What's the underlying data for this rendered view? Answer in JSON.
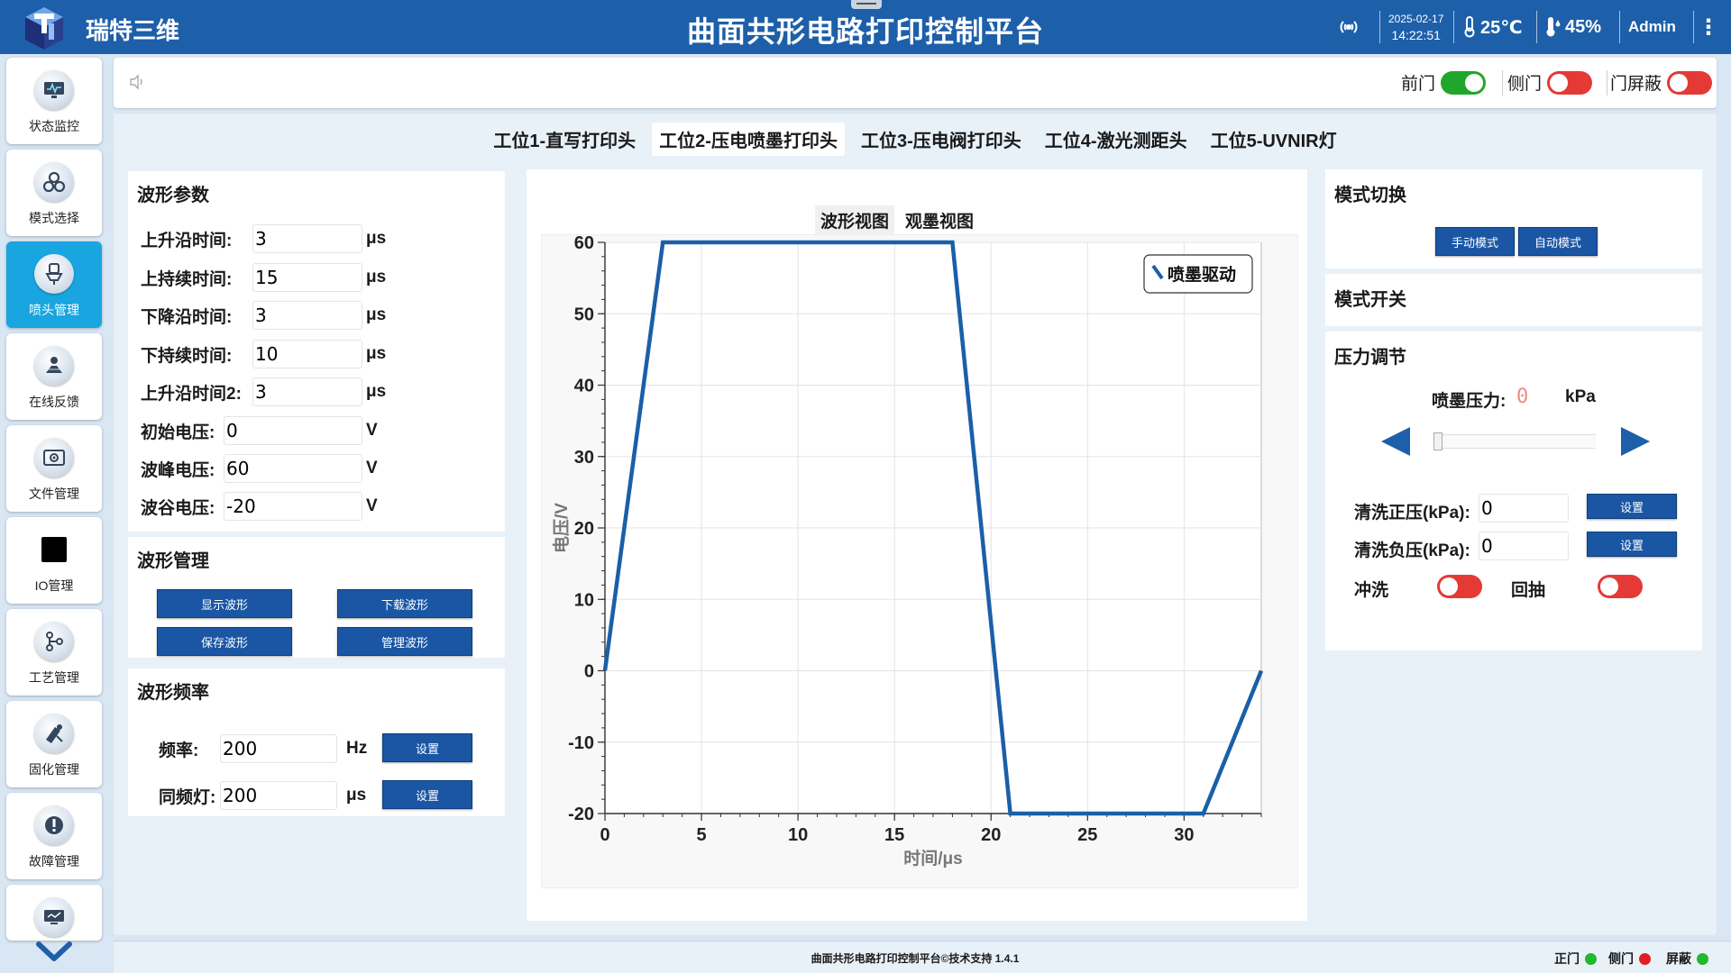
{
  "header": {
    "brand": "瑞特三维",
    "title": "曲面共形电路打印控制平台",
    "date": "2025-02-17",
    "time": "14:22:51",
    "temperature": "25℃",
    "humidity": "45%",
    "user": "Admin",
    "menu_glyph": "⋮"
  },
  "sidebar": {
    "items": [
      {
        "label": "状态监控",
        "icon": "monitor-icon"
      },
      {
        "label": "模式选择",
        "icon": "cubes-icon"
      },
      {
        "label": "喷头管理",
        "icon": "nozzle-icon",
        "active": true
      },
      {
        "label": "在线反馈",
        "icon": "feedback-icon"
      },
      {
        "label": "文件管理",
        "icon": "folder-icon"
      },
      {
        "label": "IO管理",
        "icon": "io-icon"
      },
      {
        "label": "工艺管理",
        "icon": "process-icon"
      },
      {
        "label": "固化管理",
        "icon": "curing-icon"
      },
      {
        "label": "故障管理",
        "icon": "alert-icon"
      },
      {
        "label": "",
        "icon": "screen-icon"
      }
    ]
  },
  "toolbar": {
    "doors": [
      {
        "label": "前门",
        "state": "on"
      },
      {
        "label": "侧门",
        "state": "off"
      },
      {
        "label": "门屏蔽",
        "state": "off"
      }
    ]
  },
  "tabs": [
    "工位1-直写打印头",
    "工位2-压电喷墨打印头",
    "工位3-压电阀打印头",
    "工位4-激光测距头",
    "工位5-UVNIR灯"
  ],
  "active_tab": 1,
  "waveform_params": {
    "title": "波形参数",
    "rows": [
      {
        "label": "上升沿时间:",
        "value": "3",
        "unit": "μs"
      },
      {
        "label": "上持续时间:",
        "value": "15",
        "unit": "μs"
      },
      {
        "label": "下降沿时间:",
        "value": "3",
        "unit": "μs"
      },
      {
        "label": "下持续时间:",
        "value": "10",
        "unit": "μs"
      },
      {
        "label": "上升沿时间2:",
        "value": "3",
        "unit": "μs"
      },
      {
        "label": "初始电压:",
        "value": "0",
        "unit": "V"
      },
      {
        "label": "波峰电压:",
        "value": "60",
        "unit": "V"
      },
      {
        "label": "波谷电压:",
        "value": "-20",
        "unit": "V"
      }
    ]
  },
  "waveform_manage": {
    "title": "波形管理",
    "buttons": [
      "显示波形",
      "下载波形",
      "保存波形",
      "管理波形"
    ]
  },
  "waveform_freq": {
    "title": "波形频率",
    "freq_label": "频率:",
    "freq_value": "200",
    "freq_unit": "Hz",
    "sync_label": "同频灯:",
    "sync_value": "200",
    "sync_unit": "μs",
    "set_label": "设置"
  },
  "chart_view": {
    "tabs": [
      "波形视图",
      "观墨视图"
    ],
    "active": 0
  },
  "chart_data": {
    "type": "line",
    "xlabel": "时间/μs",
    "ylabel": "电压/V",
    "xlim": [
      0,
      34
    ],
    "ylim": [
      -20,
      60
    ],
    "xticks": [
      0,
      5,
      10,
      15,
      20,
      25,
      30
    ],
    "yticks": [
      -20,
      -10,
      0,
      10,
      20,
      30,
      40,
      50,
      60
    ],
    "legend": "top-right",
    "grid": true,
    "series": [
      {
        "name": "喷墨驱动",
        "color": "#1a5fa8",
        "x": [
          0,
          3,
          18,
          21,
          31,
          34
        ],
        "y": [
          0,
          60,
          60,
          -20,
          -20,
          0
        ]
      }
    ]
  },
  "mode_switch": {
    "title": "模式切换",
    "buttons": [
      "手动模式",
      "自动模式"
    ]
  },
  "mode_toggle": {
    "title": "模式开关"
  },
  "pressure": {
    "title": "压力调节",
    "label": "喷墨压力:",
    "value": "0",
    "unit": "kPa",
    "slider_level": 0,
    "clean_pos_label": "清洗正压(kPa):",
    "clean_pos_value": "0",
    "clean_neg_label": "清洗负压(kPa):",
    "clean_neg_value": "0",
    "set_label": "设置",
    "flush_label": "冲洗",
    "retract_label": "回抽"
  },
  "footer": {
    "text": "曲面共形电路打印控制平台©技术支持 1.4.1",
    "status": [
      {
        "label": "正门",
        "color": "#22b830"
      },
      {
        "label": "侧门",
        "color": "#e02020"
      },
      {
        "label": "屏蔽",
        "color": "#22b830"
      }
    ]
  },
  "colors": {
    "header": "#1e5faa",
    "accent": "#19a5e0",
    "button": "#1a56a4",
    "toggle_on": "#21a62c",
    "toggle_off": "#e53935"
  }
}
